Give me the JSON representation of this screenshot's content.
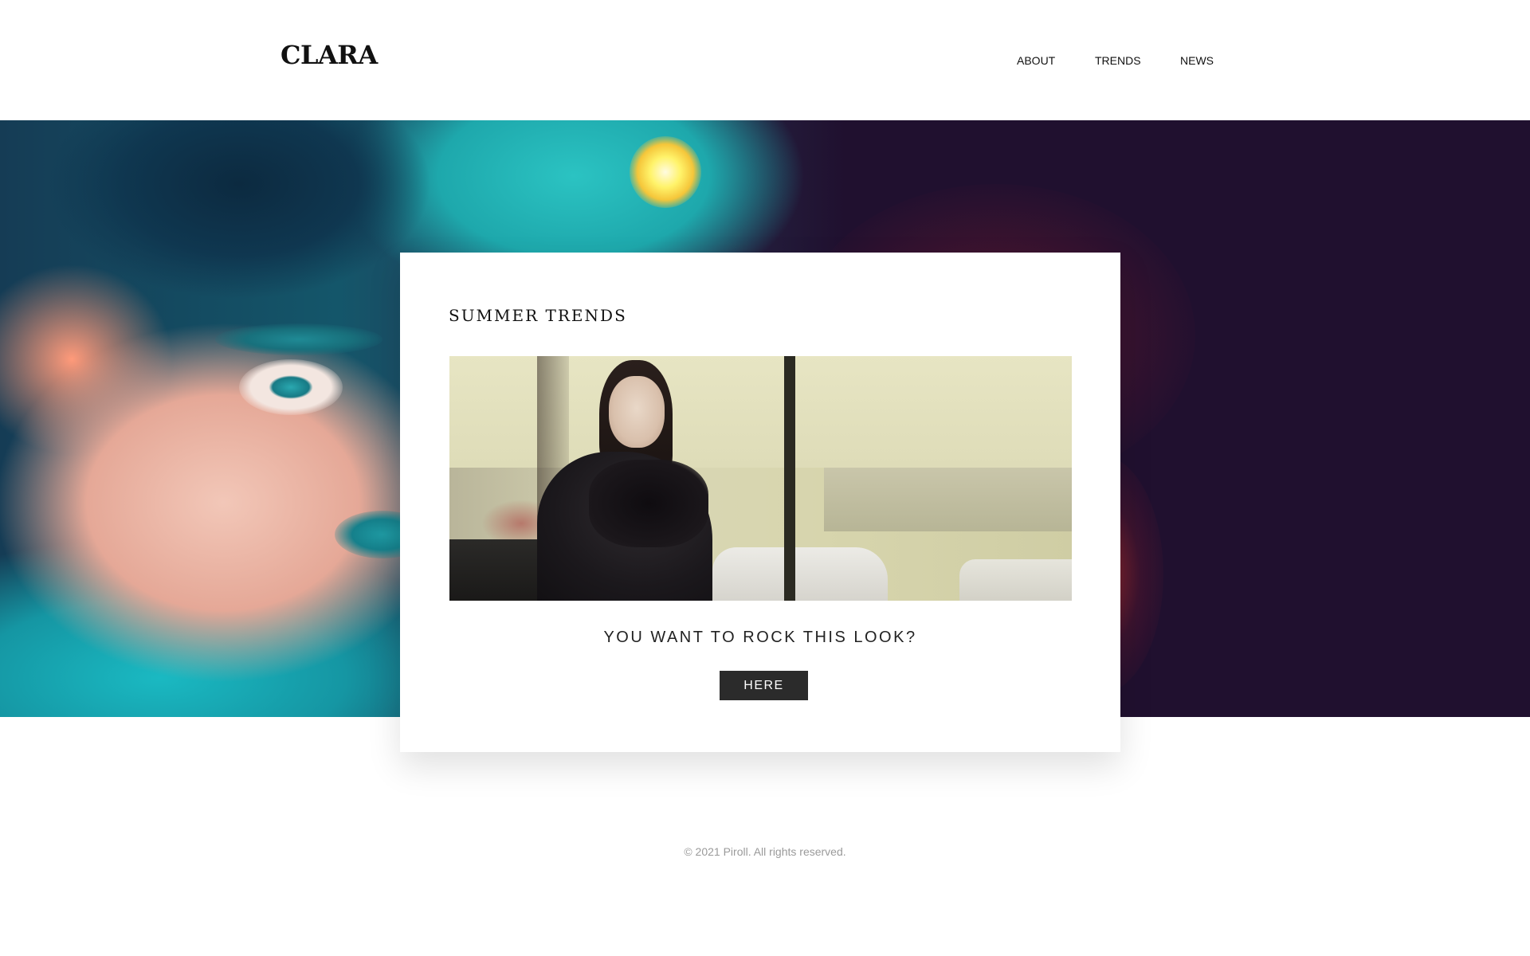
{
  "header": {
    "logo": "CLARA",
    "nav": [
      {
        "label": "ABOUT"
      },
      {
        "label": "TRENDS"
      },
      {
        "label": "NEWS"
      }
    ]
  },
  "hero": {
    "image": "fashion-portrait-image",
    "colors": {
      "background": "#20102f",
      "accent_teal": "#1ab9c2",
      "glow_red": "#b42832"
    }
  },
  "card": {
    "title": "SUMMER TRENDS",
    "image": "woman-in-black-coat-photo",
    "subtitle": "YOU WANT TO ROCK THIS LOOK?",
    "button_label": "HERE",
    "button_color": "#2b2b2b"
  },
  "footer": {
    "copyright": "© 2021 Piroll. All rights reserved."
  }
}
